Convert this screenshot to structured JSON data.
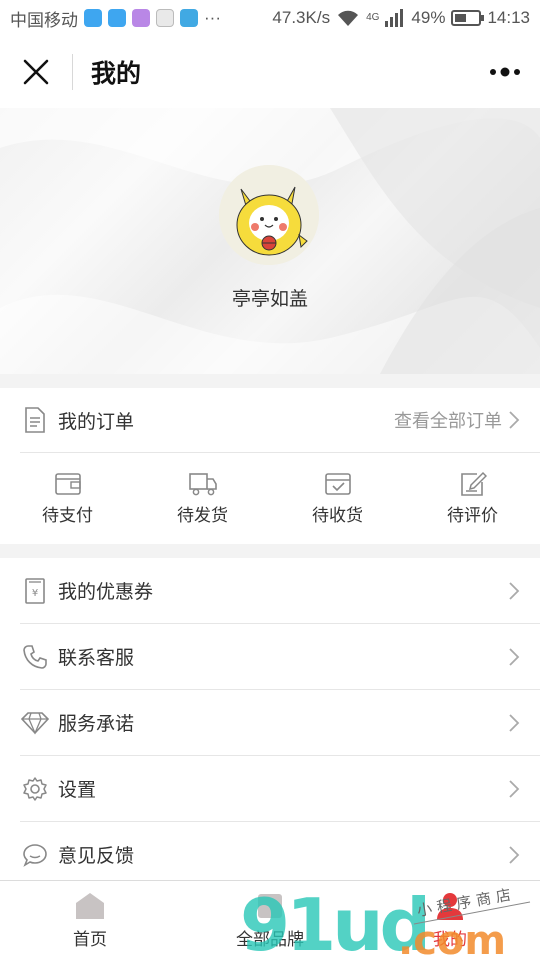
{
  "status_bar": {
    "carrier": "中国移动",
    "ellipsis": "···",
    "net_speed": "47.3K/s",
    "network_type": "4G",
    "battery": "49%",
    "battery_level": 0.49,
    "time": "14:13"
  },
  "header": {
    "title": "我的",
    "close_icon": "close-icon",
    "more_icon": "more-icon"
  },
  "profile": {
    "username": "亭亭如盖"
  },
  "orders": {
    "title": "我的订单",
    "view_all": "查看全部订单",
    "statuses": [
      {
        "label": "待支付",
        "icon": "wallet-icon"
      },
      {
        "label": "待发货",
        "icon": "truck-icon"
      },
      {
        "label": "待收货",
        "icon": "receive-icon"
      },
      {
        "label": "待评价",
        "icon": "review-icon"
      }
    ]
  },
  "menu": {
    "items": [
      {
        "label": "我的优惠券",
        "icon": "coupon-icon"
      },
      {
        "label": "联系客服",
        "icon": "phone-icon"
      },
      {
        "label": "服务承诺",
        "icon": "diamond-icon"
      },
      {
        "label": "设置",
        "icon": "gear-icon"
      },
      {
        "label": "意见反馈",
        "icon": "chat-icon"
      }
    ]
  },
  "tabbar": {
    "tabs": [
      {
        "label": "首页",
        "icon": "home-icon"
      },
      {
        "label": "全部品牌",
        "icon": "brand-icon"
      },
      {
        "label": "我的",
        "icon": "user-icon",
        "active": true
      }
    ]
  },
  "watermark": {
    "logo_text": "91ud",
    "tld": ".com",
    "tagline": "小程序商店"
  },
  "colors": {
    "accent": "#e4393c",
    "background": "#f3f3f3",
    "icon_gray": "#888888"
  }
}
